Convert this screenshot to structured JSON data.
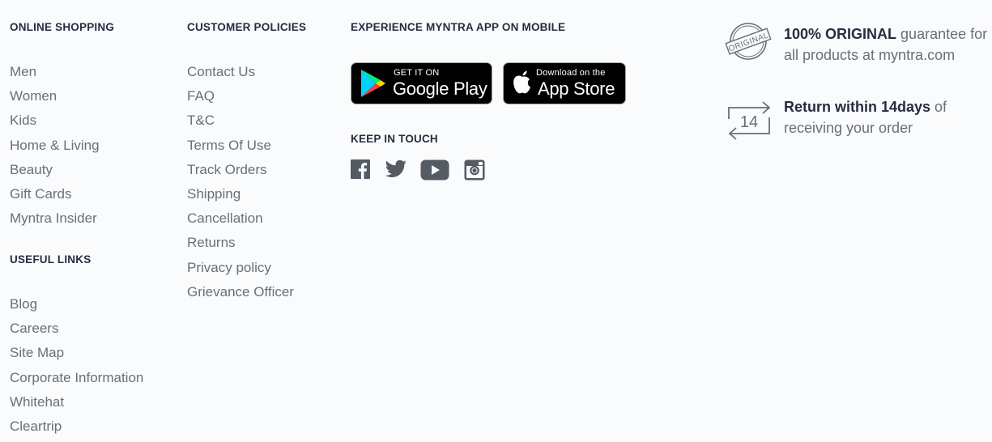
{
  "online_shopping": {
    "heading": "ONLINE SHOPPING",
    "links": [
      "Men",
      "Women",
      "Kids",
      "Home & Living",
      "Beauty",
      "Gift Cards",
      "Myntra Insider"
    ]
  },
  "useful_links": {
    "heading": "USEFUL LINKS",
    "links": [
      "Blog",
      "Careers",
      "Site Map",
      "Corporate Information",
      "Whitehat",
      "Cleartrip"
    ]
  },
  "customer_policies": {
    "heading": "CUSTOMER POLICIES",
    "links": [
      "Contact Us",
      "FAQ",
      "T&C",
      "Terms Of Use",
      "Track Orders",
      "Shipping",
      "Cancellation",
      "Returns",
      "Privacy policy",
      "Grievance Officer"
    ]
  },
  "app": {
    "heading": "EXPERIENCE MYNTRA APP ON MOBILE",
    "google_play": {
      "small": "GET IT ON",
      "big": "Google Play"
    },
    "app_store": {
      "small": "Download on the",
      "big": "App Store"
    }
  },
  "keep_in_touch": {
    "heading": "KEEP IN TOUCH",
    "icons": [
      "facebook-icon",
      "twitter-icon",
      "youtube-icon",
      "instagram-icon"
    ]
  },
  "promises": {
    "original": {
      "strong": "100% ORIGINAL",
      "rest": " guarantee for all products at myntra.com",
      "badge_text": "ORIGINAL"
    },
    "returns": {
      "strong": "Return within 14days",
      "rest": " of receiving your order",
      "badge_number": "14"
    }
  },
  "colors": {
    "heading": "#282c3f",
    "link": "#696e79",
    "icon": "#555b63",
    "background": "#fafbfc"
  }
}
